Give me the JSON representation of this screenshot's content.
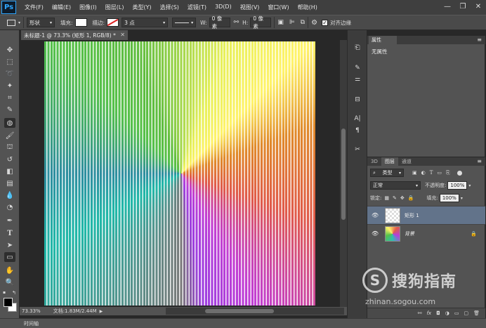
{
  "app": {
    "logo": "Ps"
  },
  "menubar": {
    "items": [
      "文件(F)",
      "编辑(E)",
      "图像(I)",
      "图层(L)",
      "类型(Y)",
      "选择(S)",
      "滤镜(T)",
      "3D(D)",
      "视图(V)",
      "窗口(W)",
      "帮助(H)"
    ],
    "minimize": "—",
    "restore": "❐",
    "close": "✕"
  },
  "options": {
    "shape_mode": "形状",
    "fill_label": "填充:",
    "stroke_label": "描边:",
    "stroke_width": "3 点",
    "w_label": "W:",
    "w_value": "0 像素",
    "h_label": "H:",
    "h_value": "0 像素",
    "align_edges": "对齐边缘"
  },
  "document": {
    "tab_title": "未标题-1 @ 73.3% (矩形 1, RGB/8) *",
    "zoom": "73.33%",
    "doc_size": "文档:1.83M/2.44M"
  },
  "timeline": {
    "label": "时间轴"
  },
  "properties": {
    "tab": "属性",
    "body": "无属性"
  },
  "layers": {
    "tabs": [
      "3D",
      "图层",
      "通道"
    ],
    "filter_kind": "类型",
    "blend_mode": "正常",
    "opacity_label": "不透明度:",
    "opacity": "100%",
    "lock_label": "锁定:",
    "fill_label": "填充:",
    "fill": "100%",
    "rows": [
      {
        "name": "矩形 1",
        "selected": true
      },
      {
        "name": "背景",
        "selected": false
      }
    ],
    "footer_icons": [
      "link-icon",
      "fx-icon",
      "mask-icon",
      "adjustment-icon",
      "group-icon",
      "new-layer-icon",
      "trash-icon"
    ],
    "footer_glyphs": [
      "⚯",
      "fx",
      "◘",
      "◑",
      "▭",
      "▢",
      "🗑"
    ]
  },
  "watermark": {
    "brand_cn": "搜狗指南",
    "url": "zhinan.sogou.com"
  },
  "colors": {
    "accent": "#31a8ff",
    "selected_layer": "#62738a",
    "panel": "#535353"
  }
}
